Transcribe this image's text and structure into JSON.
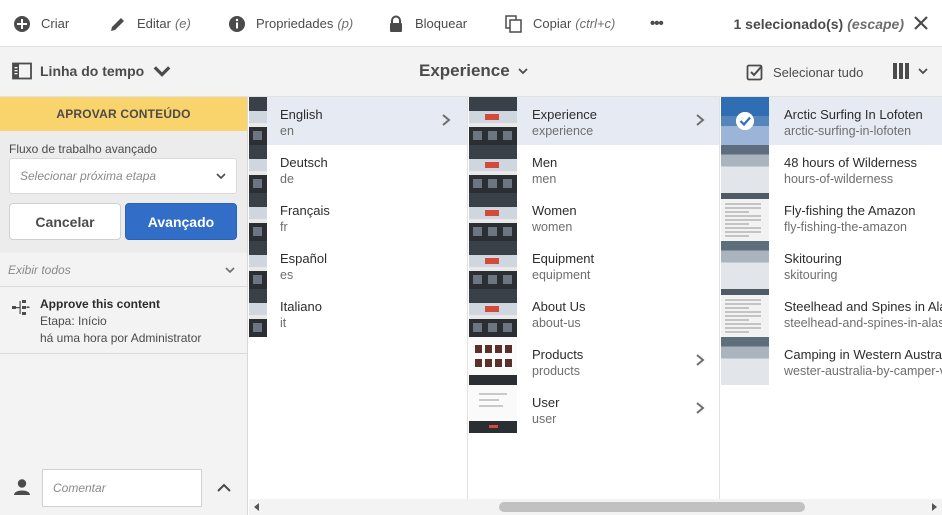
{
  "topbar": {
    "create": {
      "label": "Criar",
      "icon": "plus-circle-icon"
    },
    "edit": {
      "label": "Editar",
      "shortcut": "(e)",
      "icon": "pencil-icon"
    },
    "properties": {
      "label": "Propriedades",
      "shortcut": "(p)",
      "icon": "info-icon"
    },
    "lock": {
      "label": "Bloquear",
      "icon": "lock-icon"
    },
    "copy": {
      "label": "Copiar",
      "shortcut": "(ctrl+c)",
      "icon": "copy-icon"
    },
    "more": {
      "label": "•••",
      "icon": "more-icon"
    },
    "selection": {
      "count_label": "1 selecionado(s)",
      "escape_label": "(escape)"
    }
  },
  "toolbar": {
    "rail_label": "Linha do tempo",
    "breadcrumb": "Experience",
    "select_all": "Selecionar tudo"
  },
  "rail": {
    "approve_title": "APROVAR CONTEÚDO",
    "workflow_label": "Fluxo de trabalho avançado",
    "workflow_placeholder": "Selecionar próxima etapa",
    "cancel": "Cancelar",
    "advance": "Avançado",
    "show_all": "Exibir todos",
    "task": {
      "title": "Approve this content",
      "step": "Etapa: Início",
      "meta": "há uma hora por Administrator"
    },
    "comment_placeholder": "Comentar"
  },
  "columns": {
    "languages": [
      {
        "title": "English",
        "name": "en",
        "has_children": true,
        "selected": true
      },
      {
        "title": "Deutsch",
        "name": "de"
      },
      {
        "title": "Français",
        "name": "fr"
      },
      {
        "title": "Español",
        "name": "es"
      },
      {
        "title": "Italiano",
        "name": "it"
      }
    ],
    "sections": [
      {
        "title": "Experience",
        "name": "experience",
        "has_children": true,
        "selected": true
      },
      {
        "title": "Men",
        "name": "men"
      },
      {
        "title": "Women",
        "name": "women"
      },
      {
        "title": "Equipment",
        "name": "equipment"
      },
      {
        "title": "About Us",
        "name": "about-us"
      },
      {
        "title": "Products",
        "name": "products",
        "has_children": true
      },
      {
        "title": "User",
        "name": "user",
        "has_children": true
      }
    ],
    "pages": [
      {
        "title": "Arctic Surfing In Lofoten",
        "name": "arctic-surfing-in-lofoten",
        "selected": true
      },
      {
        "title": "48 hours of Wilderness",
        "name": "hours-of-wilderness"
      },
      {
        "title": "Fly-fishing the Amazon",
        "name": "fly-fishing-the-amazon"
      },
      {
        "title": "Skitouring",
        "name": "skitouring"
      },
      {
        "title": "Steelhead and Spines in Alaska",
        "name": "steelhead-and-spines-in-alaska"
      },
      {
        "title": "Camping in Western Australia",
        "name": "wester-australia-by-camper-van"
      }
    ]
  },
  "colors": {
    "accent": "#326ec8",
    "approve_banner": "#f9d36b",
    "selected_row": "#e6ebf3"
  }
}
